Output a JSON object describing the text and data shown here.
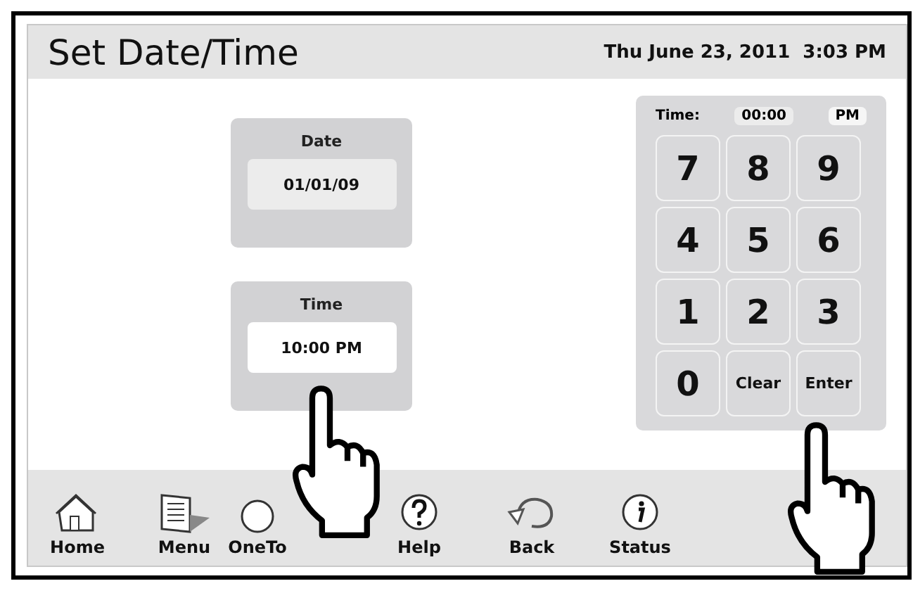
{
  "header": {
    "title": "Set Date/Time",
    "datetime": "Thu June 23, 2011  3:03 PM"
  },
  "fields": [
    {
      "label": "Date",
      "value": "01/01/09",
      "selected": false
    },
    {
      "label": "Time",
      "value": "10:00 PM",
      "selected": true
    }
  ],
  "keypad": {
    "label": "Time:",
    "display": "00:00",
    "period": "PM",
    "keys": [
      {
        "label": "7",
        "kind": "digit"
      },
      {
        "label": "8",
        "kind": "digit"
      },
      {
        "label": "9",
        "kind": "digit"
      },
      {
        "label": "4",
        "kind": "digit"
      },
      {
        "label": "5",
        "kind": "digit"
      },
      {
        "label": "6",
        "kind": "digit"
      },
      {
        "label": "1",
        "kind": "digit"
      },
      {
        "label": "2",
        "kind": "digit"
      },
      {
        "label": "3",
        "kind": "digit"
      },
      {
        "label": "0",
        "kind": "digit"
      },
      {
        "label": "Clear",
        "kind": "command"
      },
      {
        "label": "Enter",
        "kind": "command"
      }
    ]
  },
  "toolbar": [
    {
      "label": "Home",
      "kind": "home"
    },
    {
      "label": "Menu",
      "kind": "menu"
    },
    {
      "label": "OneTo",
      "kind": "onetouch"
    },
    {
      "label": "Help",
      "kind": "help"
    },
    {
      "label": "Back",
      "kind": "back"
    },
    {
      "label": "Status",
      "kind": "status"
    }
  ]
}
